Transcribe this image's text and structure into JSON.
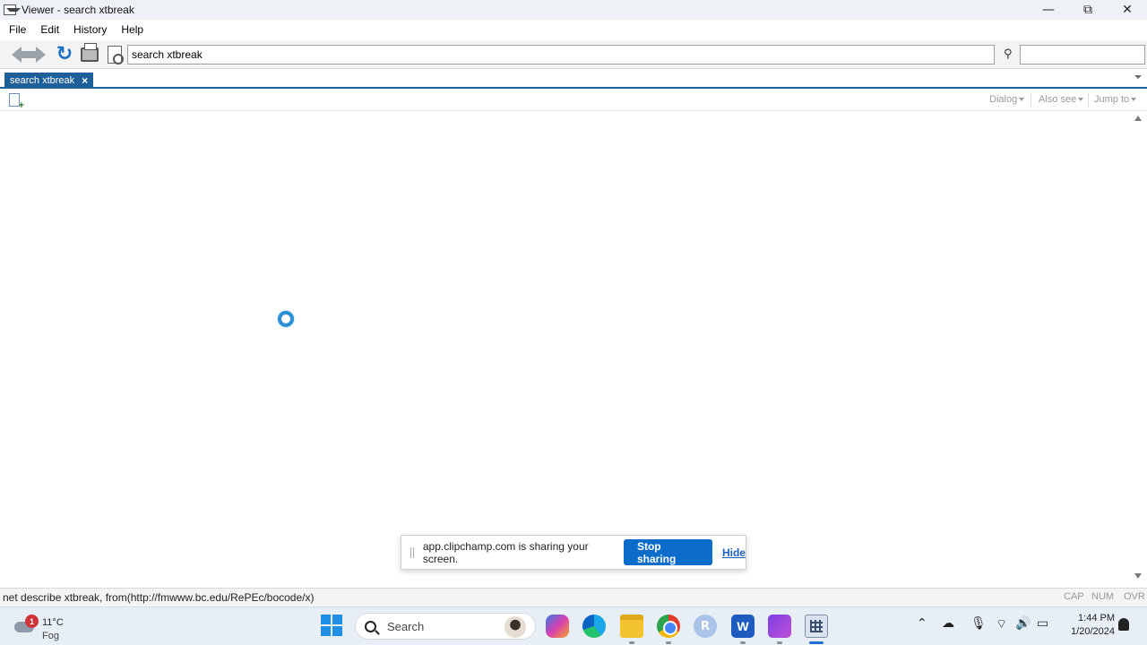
{
  "window": {
    "title": "Viewer - search xtbreak",
    "minimize": "—",
    "maximize": "⧉",
    "close": "✕"
  },
  "menu": [
    "File",
    "Edit",
    "History",
    "Help"
  ],
  "toolbar": {
    "command_value": "search xtbreak"
  },
  "tabs": [
    {
      "label": "search xtbreak",
      "close": "×"
    }
  ],
  "viewer_menus": {
    "dialog": "Dialog",
    "also_see": "Also see",
    "jump_to": "Jump to"
  },
  "share_banner": {
    "message": "app.clipchamp.com is sharing your screen.",
    "stop_label": "Stop sharing",
    "hide_label": "Hide"
  },
  "status": {
    "text": "net describe xtbreak, from(http://fmwww.bc.edu/RePEc/bocode/x)",
    "cap": "CAP",
    "num": "NUM",
    "ovr": "OVR"
  },
  "taskbar": {
    "weather_temp": "11°C",
    "weather_cond": "Fog",
    "weather_badge": "1",
    "search_label": "Search",
    "r_app_letter": "R",
    "word_letter": "W",
    "time": "1:44 PM",
    "date": "1/20/2024"
  },
  "colors": {
    "tab_active": "#1f5f99",
    "stop_button": "#0b6cc9",
    "spinner": "#2d8fd6"
  }
}
